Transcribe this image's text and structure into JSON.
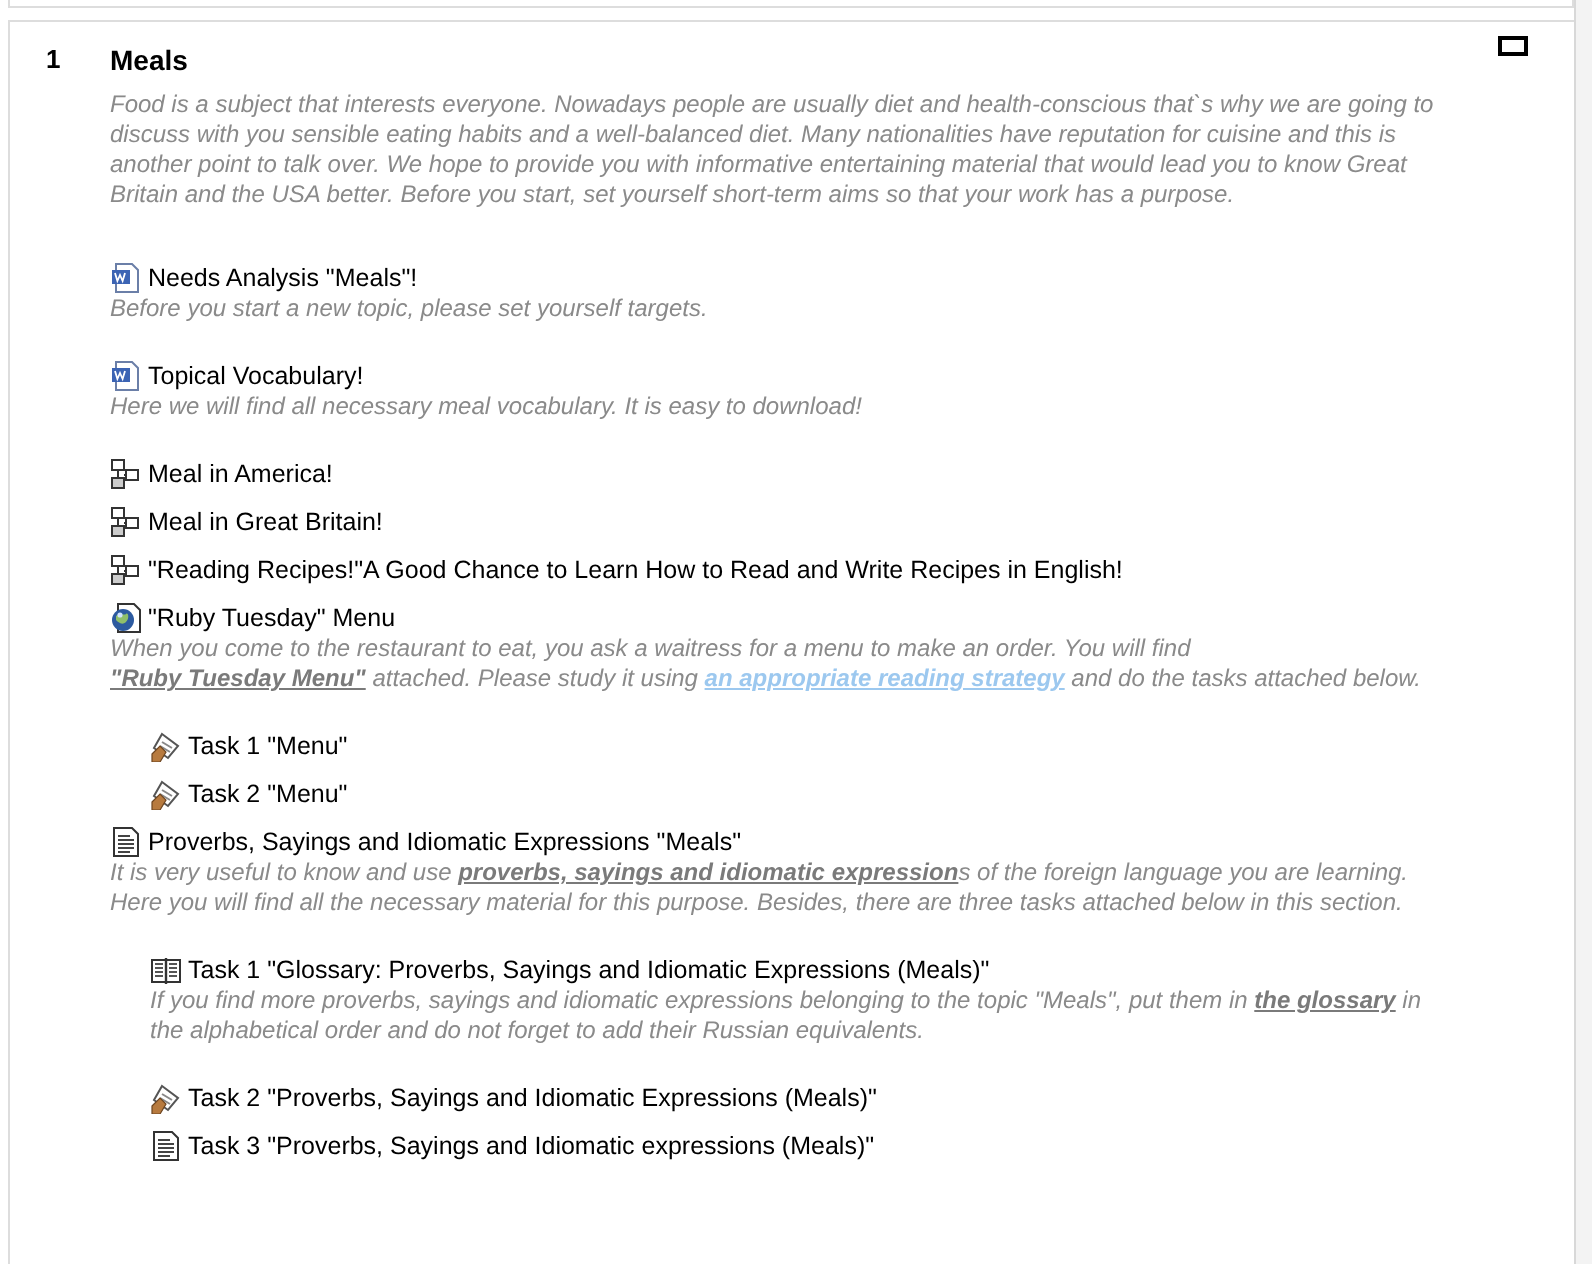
{
  "section": {
    "number": "1",
    "title": "Meals",
    "summary": "Food is a subject that interests everyone. Nowadays people are usually diet and health-conscious that`s why we are going to discuss with you sensible eating habits and a well-balanced diet. Many nationalities have reputation for cuisine and this is another point to talk over. We hope to provide you with informative entertaining material that would lead you to know Great Britain and the USA better. Before you start, set yourself short-term aims so that your work has a purpose.",
    "activities": [
      {
        "kind": "word",
        "title": "Needs Analysis \"Meals\"!",
        "description": [
          {
            "kind": "text",
            "text": "Before you start a new topic, please set yourself targets."
          }
        ]
      },
      {
        "kind": "word",
        "title": "Topical Vocabulary!",
        "description": [
          {
            "kind": "text",
            "text": "Here we will find all necessary meal vocabulary. It is easy to download!"
          }
        ]
      },
      {
        "kind": "structure",
        "title": "Meal in America!"
      },
      {
        "kind": "structure",
        "title": "Meal in Great Britain!"
      },
      {
        "kind": "structure",
        "title": "\"Reading Recipes!\"A Good Chance to Learn How to Read and Write Recipes in English!"
      },
      {
        "kind": "web",
        "title": "\"Ruby Tuesday\" Menu",
        "description": [
          {
            "kind": "text",
            "text": "When you come to the restaurant to eat, you ask a waitress for a menu to make an order. You will find "
          },
          {
            "kind": "link",
            "visited": true,
            "text": "\"Ruby Tuesday Menu\""
          },
          {
            "kind": "text",
            "text": " attached. Please study it using "
          },
          {
            "kind": "link",
            "visited": false,
            "text": "an appropriate reading strategy"
          },
          {
            "kind": "text",
            "text": " and do the tasks attached below."
          }
        ],
        "children": [
          {
            "kind": "assignment",
            "title": "Task 1 \"Menu\""
          },
          {
            "kind": "assignment",
            "title": "Task 2 \"Menu\""
          }
        ]
      },
      {
        "kind": "page",
        "title": "Proverbs, Sayings and Idiomatic Expressions \"Meals\"",
        "description": [
          {
            "kind": "text",
            "text": "It is very useful to know and use "
          },
          {
            "kind": "link",
            "visited": true,
            "text": "proverbs, sayings and idiomatic expression"
          },
          {
            "kind": "text",
            "text": "s of the foreign language you are learning. Here you will find all the necessary material for this purpose. Besides, there are three tasks attached below in this section."
          }
        ],
        "children": [
          {
            "kind": "glossary",
            "title": "Task 1 \"Glossary: Proverbs, Sayings and Idiomatic Expressions (Meals)\"",
            "description": [
              {
                "kind": "text",
                "text": "If you find more proverbs, sayings and idiomatic expressions belonging to the topic \"Meals\", put them in "
              },
              {
                "kind": "link",
                "visited": true,
                "text": "the glossary"
              },
              {
                "kind": "text",
                "text": " in the alphabetical order and do not forget to add their Russian equivalents."
              }
            ]
          },
          {
            "kind": "assignment",
            "title": "Task 2 \"Proverbs, Sayings and Idiomatic Expressions (Meals)\""
          },
          {
            "kind": "page",
            "title": "Task 3 \"Proverbs, Sayings and Idiomatic expressions (Meals)\""
          }
        ]
      }
    ]
  }
}
